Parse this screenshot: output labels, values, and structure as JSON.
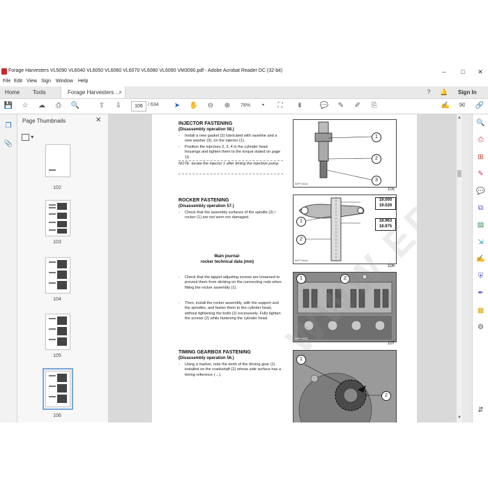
{
  "window": {
    "title": "Forage Harvesters VL5090 VL6040  VL6050  VL6060 VL6070 VL6080 VL6090 VM3090.pdf - Adobe Acrobat Reader DC (32-bit)",
    "minimize": "–",
    "maximize": "□",
    "close": "✕"
  },
  "menu": [
    "File",
    "Edit",
    "View",
    "Sign",
    "Window",
    "Help"
  ],
  "tabs": {
    "home": "Home",
    "tools": "Tools",
    "document": "Forage Harvesters ...",
    "close_glyph": "×",
    "sign_in": "Sign In"
  },
  "toolbar": {
    "current_page": "106",
    "page_count": "/ 634",
    "zoom": "78%"
  },
  "thumbnails": {
    "header": "Page Thumbnails",
    "close_glyph": "✕",
    "pages": [
      "102",
      "103",
      "104",
      "105",
      "106"
    ],
    "selected": "106"
  },
  "document": {
    "watermark": "WWW.EPCDEPO.COM",
    "injector": {
      "title": "INJECTOR FASTENING",
      "subtitle": "(Disassembly operation 58.)",
      "bullets": [
        "Install a new gasket (2) lubricated with vaseline and a new washer (3), on the injector (1).",
        "Position the injectors 2, 3, 4 in the cylinder head housings and tighten them to the torque stated on page 15."
      ],
      "note": "NOTE: locate the injector 1 after timing the injection pump.",
      "figure_number": "105",
      "figure_code": "IMP7263A",
      "callouts": [
        "1",
        "2",
        "3"
      ]
    },
    "rocker": {
      "title": "ROCKER FASTENING",
      "subtitle": "(Disassembly operation 57.)",
      "bullets": [
        "Check that the assembly surfaces of the spindle (2) / rocker (1) are not worn nor damaged."
      ],
      "center_label": "Main journal-\nrocker technical data (mm)",
      "bullets2": [
        "Check that the tappet adjusting screws are loosened to prevent them from sticking on the connecting rods when fitting the rocker assembly (1).",
        "Then, install the rocker assembly, with the support and the spindles, and fasten them to the cylinder head, without tightening the bolts (2) excessively. Fully tighten the screws (2) while fastening the cylinder head."
      ],
      "figure_number": "106",
      "figure_code": "IMP7264A",
      "dim_top": [
        "19.000",
        "19.026"
      ],
      "dim_bottom": [
        "18.963",
        "18.975"
      ],
      "callouts": [
        "1",
        "2"
      ],
      "figure2_number": "107",
      "figure2_code": "IMP7265A",
      "figure2_callouts": [
        "1",
        "2"
      ]
    },
    "timing": {
      "title": "TIMING GEARBOX FASTENING",
      "subtitle": "(Disassembly operation 56.)",
      "bullets": [
        "Using a marker, note the tooth of the driving gear (1) installed on the crankshaft (2) whose side surface has a timing reference (→)."
      ],
      "callouts": [
        "1",
        "2"
      ]
    }
  }
}
